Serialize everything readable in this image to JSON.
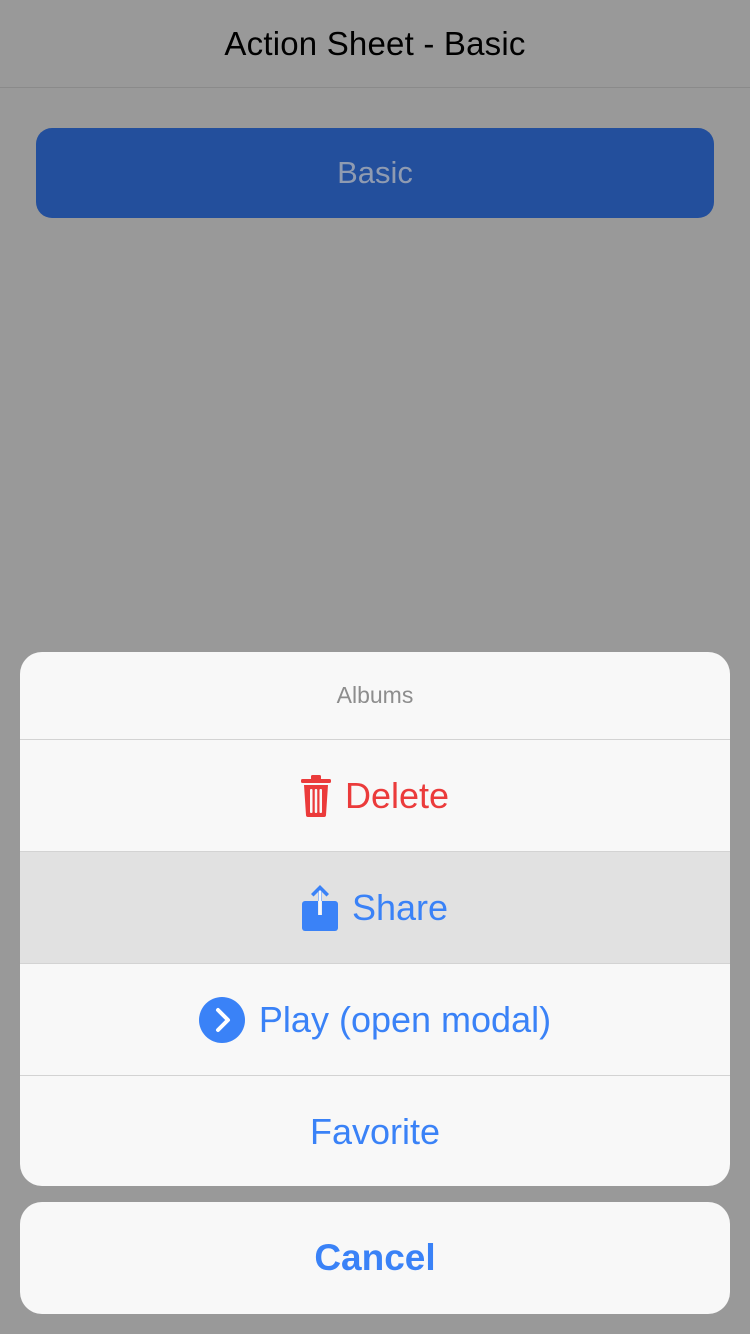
{
  "navbar": {
    "title": "Action Sheet - Basic"
  },
  "main": {
    "basic_button_label": "Basic"
  },
  "action_sheet": {
    "header": "Albums",
    "items": [
      {
        "label": "Delete",
        "icon": "trash-icon",
        "role": "destructive"
      },
      {
        "label": "Share",
        "icon": "share-icon",
        "pressed": true
      },
      {
        "label": "Play (open modal)",
        "icon": "chevron-right-circle-icon"
      },
      {
        "label": "Favorite"
      }
    ],
    "cancel_label": "Cancel"
  },
  "colors": {
    "backdrop": "#999999",
    "primary": "#3a82f7",
    "destructive": "#eb3b3b",
    "basic_button_bg": "#234f9c",
    "sheet_bg": "#f8f8f8",
    "pressed_bg": "#e1e1e1"
  }
}
